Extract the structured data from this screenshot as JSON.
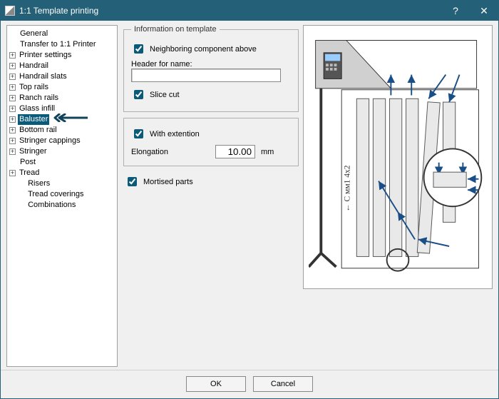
{
  "window": {
    "title": "1:1 Template printing",
    "help": "?",
    "close": "✕"
  },
  "tree": {
    "items": [
      {
        "label": "General",
        "expander": ""
      },
      {
        "label": "Transfer to 1:1 Printer",
        "expander": ""
      },
      {
        "label": "Printer settings",
        "expander": "+"
      },
      {
        "label": "Handrail",
        "expander": "+"
      },
      {
        "label": "Handrail slats",
        "expander": "+"
      },
      {
        "label": "Top rails",
        "expander": "+"
      },
      {
        "label": "Ranch rails",
        "expander": "+"
      },
      {
        "label": "Glass infill",
        "expander": "+"
      },
      {
        "label": "Baluster",
        "expander": "+",
        "selected": true,
        "arrow": true
      },
      {
        "label": "Bottom rail",
        "expander": "+"
      },
      {
        "label": "Stringer cappings",
        "expander": "+"
      },
      {
        "label": "Stringer",
        "expander": "+"
      },
      {
        "label": "Post",
        "expander": ""
      },
      {
        "label": "Tread",
        "expander": "+"
      },
      {
        "label": "Risers",
        "expander": "",
        "indent": true
      },
      {
        "label": "Tread coverings",
        "expander": "",
        "indent": true
      },
      {
        "label": "Combinations",
        "expander": "",
        "indent": true
      }
    ]
  },
  "form": {
    "groupTitle": "Information on template",
    "neighboring": {
      "label": "Neighboring component above",
      "checked": true
    },
    "headerLabel": "Header for name:",
    "headerValue": "",
    "sliceCut": {
      "label": "Slice cut",
      "checked": true
    },
    "withExt": {
      "label": "With extention",
      "checked": true
    },
    "elongationLabel": "Elongation",
    "elongationValue": "10.00",
    "elongationUnit": "mm",
    "mortised": {
      "label": "Mortised parts",
      "checked": true
    }
  },
  "buttons": {
    "ok": "OK",
    "cancel": "Cancel"
  }
}
